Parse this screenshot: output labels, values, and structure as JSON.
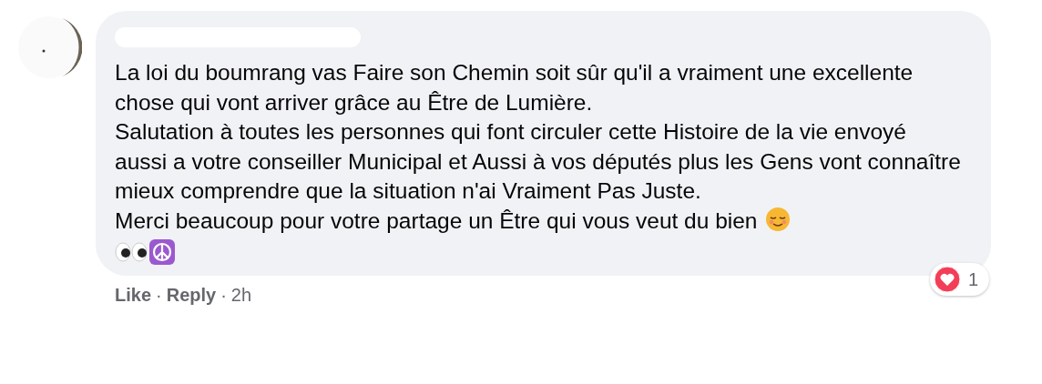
{
  "comment": {
    "paragraphs": [
      "La loi du boumrang vas Faire son Chemin soit sûr qu'il a vraiment une excellente chose qui vont arriver grâce au Être de Lumière.",
      "Salutation à toutes les personnes qui font circuler cette Histoire de la vie envoyé aussi a votre conseiller Municipal et Aussi à vos députés plus les Gens vont connaître mieux comprendre que la situation n'ai Vraiment Pas Juste.",
      "Merci beaucoup pour votre partage un Être qui vous veut du bien"
    ],
    "reactions": {
      "count": "1"
    },
    "actions": [
      {
        "label": "Like",
        "kind": "link"
      },
      {
        "label": "·",
        "kind": "separator"
      },
      {
        "label": "Reply",
        "kind": "link"
      },
      {
        "label": "·",
        "kind": "separator"
      },
      {
        "label": "2h",
        "kind": "time"
      }
    ]
  }
}
